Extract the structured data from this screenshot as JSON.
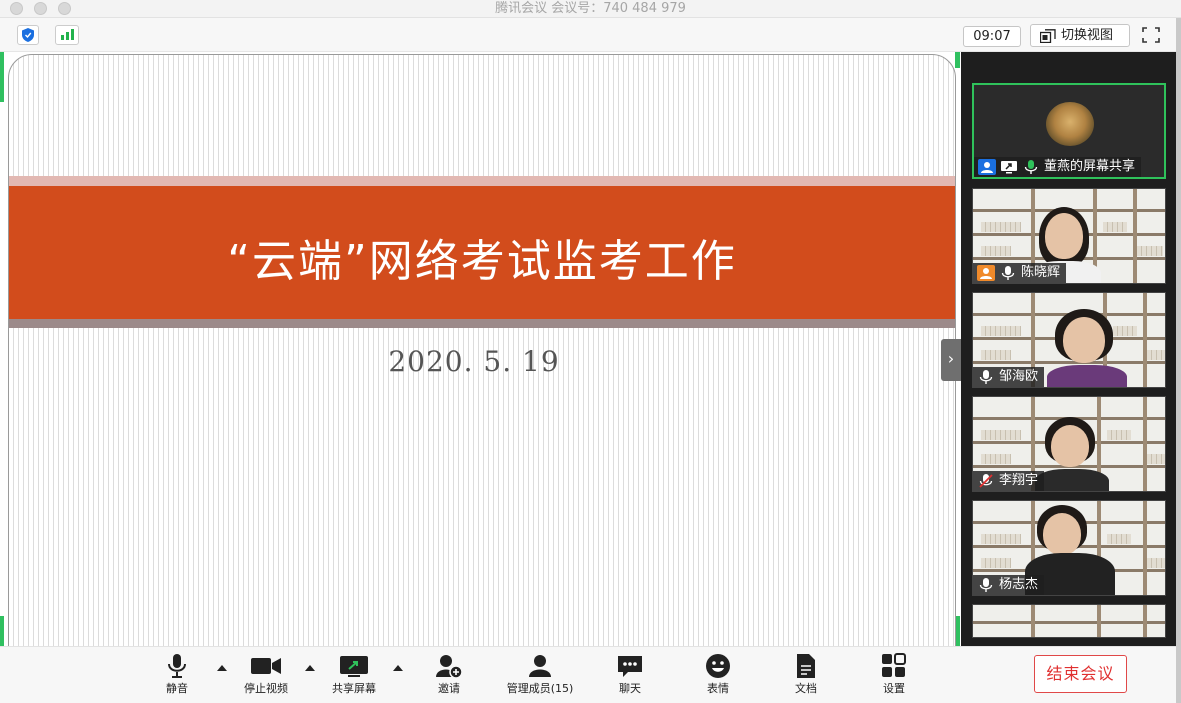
{
  "window": {
    "title": "腾讯会议 会议号：740 484 979"
  },
  "top_bar": {
    "time": "09:07",
    "switch_view_label": "切换视图"
  },
  "slide": {
    "title": "“云端”网络考试监考工作",
    "date": "2020. 5. 19",
    "colors": {
      "band": "#d24c1c",
      "band_top": "#e2b8b2",
      "band_bottom": "#9c8a8a"
    }
  },
  "gallery": {
    "tiles": [
      {
        "name": "董燕的屏幕共享",
        "active": true,
        "icons": [
          "person-icon",
          "screen-share-icon",
          "mic-on-icon"
        ]
      },
      {
        "name": "陈晓辉",
        "active": false,
        "icons": [
          "person-icon",
          "mic-on-icon"
        ]
      },
      {
        "name": "邹海欧",
        "active": false,
        "icons": [
          "mic-on-icon"
        ]
      },
      {
        "name": "李翔宇",
        "active": false,
        "icons": [
          "mic-muted-icon"
        ]
      },
      {
        "name": "杨志杰",
        "active": false,
        "icons": [
          "mic-on-icon"
        ]
      }
    ]
  },
  "toolbar": {
    "mute": "静音",
    "stop_video": "停止视频",
    "share_screen": "共享屏幕",
    "invite": "邀请",
    "manage_members": "管理成员(15)",
    "chat": "聊天",
    "reactions": "表情",
    "docs": "文档",
    "settings": "设置",
    "end_meeting": "结束会议"
  },
  "accent_colors": {
    "green": "#2fc25b",
    "end_red": "#e03030",
    "blue": "#1a6fe0"
  }
}
